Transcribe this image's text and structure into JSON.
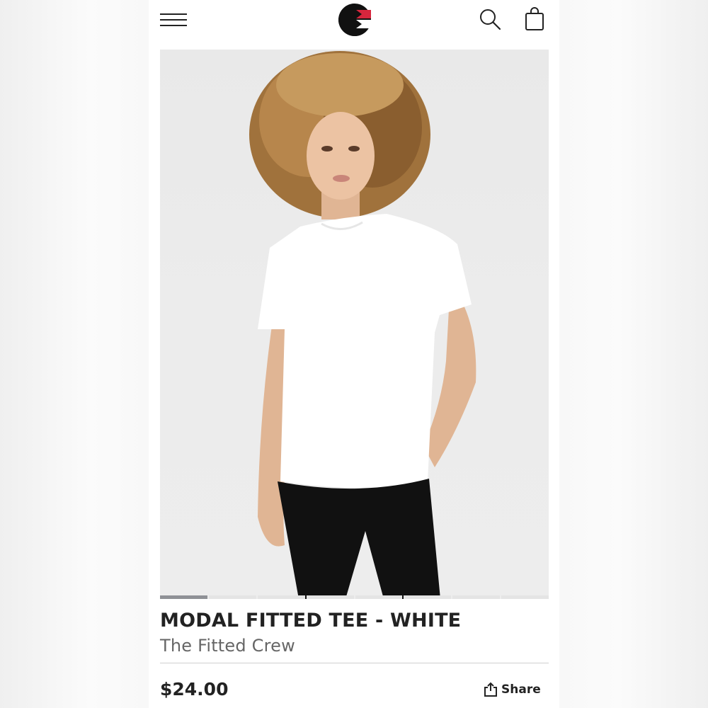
{
  "header": {
    "menu_icon": "hamburger-menu-icon",
    "logo_icon": "brand-logo-icon",
    "search_icon": "search-icon",
    "bag_icon": "shopping-bag-icon"
  },
  "product": {
    "title": "MODAL FITTED TEE - WHITE",
    "subtitle": "The Fitted Crew",
    "price": "$24.00",
    "image_count": 8,
    "active_image": 1
  },
  "actions": {
    "share_label": "Share",
    "share_icon": "share-icon"
  },
  "colors": {
    "text": "#222222",
    "subtext": "#666666",
    "logo_red": "#d7263d",
    "pager_active": "#8f9196"
  }
}
